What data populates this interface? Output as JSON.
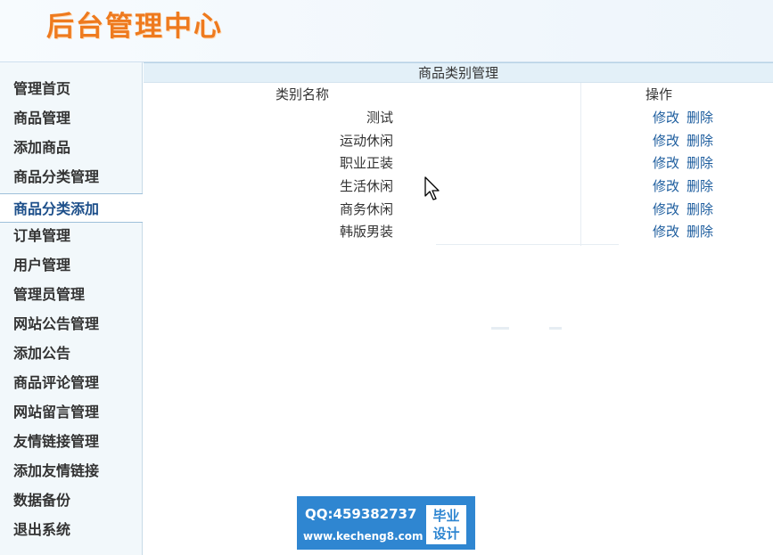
{
  "header": {
    "title": "后台管理中心"
  },
  "sidebar": {
    "items": [
      {
        "label": "管理首页"
      },
      {
        "label": "商品管理"
      },
      {
        "label": "添加商品"
      },
      {
        "label": "商品分类管理"
      },
      {
        "label": "商品分类添加",
        "active": true
      },
      {
        "label": "订单管理"
      },
      {
        "label": "用户管理"
      },
      {
        "label": "管理员管理"
      },
      {
        "label": "网站公告管理"
      },
      {
        "label": "添加公告"
      },
      {
        "label": "商品评论管理"
      },
      {
        "label": "网站留言管理"
      },
      {
        "label": "友情链接管理"
      },
      {
        "label": "添加友情链接"
      },
      {
        "label": "数据备份"
      },
      {
        "label": "退出系统"
      }
    ]
  },
  "main": {
    "panel_title": "商品类别管理",
    "columns": {
      "name": "类别名称",
      "actions": "操作"
    },
    "rows": [
      {
        "name": "测试",
        "edit": "修改",
        "delete": "删除"
      },
      {
        "name": "运动休闲",
        "edit": "修改",
        "delete": "删除"
      },
      {
        "name": "职业正装",
        "edit": "修改",
        "delete": "删除"
      },
      {
        "name": "生活休闲",
        "edit": "修改",
        "delete": "删除"
      },
      {
        "name": "商务休闲",
        "edit": "修改",
        "delete": "删除"
      },
      {
        "name": "韩版男装",
        "edit": "修改",
        "delete": "删除"
      }
    ]
  },
  "watermark": {
    "qq": "QQ:459382737",
    "site": "www.kecheng8.com",
    "badge_line1": "毕业",
    "badge_line2": "设计"
  },
  "colors": {
    "title_orange": "#ee7a1e",
    "link_blue": "#1d5d9e",
    "active_blue": "#1d4f8a",
    "watermark_blue": "#2f86d1"
  }
}
